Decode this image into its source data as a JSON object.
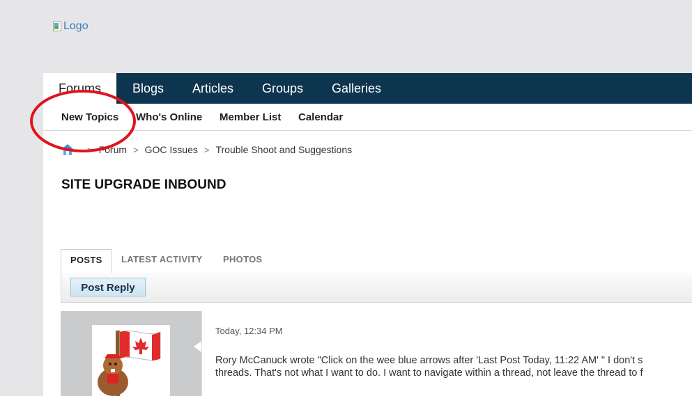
{
  "logo": {
    "alt_text": "Logo"
  },
  "navbar": {
    "tabs": [
      {
        "label": "Forums",
        "active": true
      },
      {
        "label": "Blogs"
      },
      {
        "label": "Articles"
      },
      {
        "label": "Groups"
      },
      {
        "label": "Galleries"
      }
    ]
  },
  "subnav": {
    "items": [
      {
        "label": "New Topics"
      },
      {
        "label": "Who's Online"
      },
      {
        "label": "Member List"
      },
      {
        "label": "Calendar"
      }
    ]
  },
  "breadcrumb": {
    "home_icon": "home-icon",
    "items": [
      "Forum",
      "GOC Issues",
      "Trouble Shoot and Suggestions"
    ],
    "separator": ">"
  },
  "page_title": "SITE UPGRADE INBOUND",
  "content_tabs": [
    {
      "label": "POSTS",
      "active": true
    },
    {
      "label": "LATEST ACTIVITY"
    },
    {
      "label": "PHOTOS"
    }
  ],
  "toolbar": {
    "post_reply_label": "Post Reply"
  },
  "post": {
    "date": "Today, 12:34 PM",
    "line1": "Rory McCanuck wrote \"Click on the wee blue arrows after 'Last Post Today, 11:22 AM' \" I don't s",
    "line2": "threads. That's not what I want to do. I want to navigate within a thread, not leave the thread to f",
    "avatar": "canadian-beaver-flag-avatar"
  },
  "colors": {
    "navbar_bg": "#0d3550",
    "page_bg": "#e6e6e8",
    "annotation": "#e0141c",
    "button_bg": "#d8eaf6"
  }
}
